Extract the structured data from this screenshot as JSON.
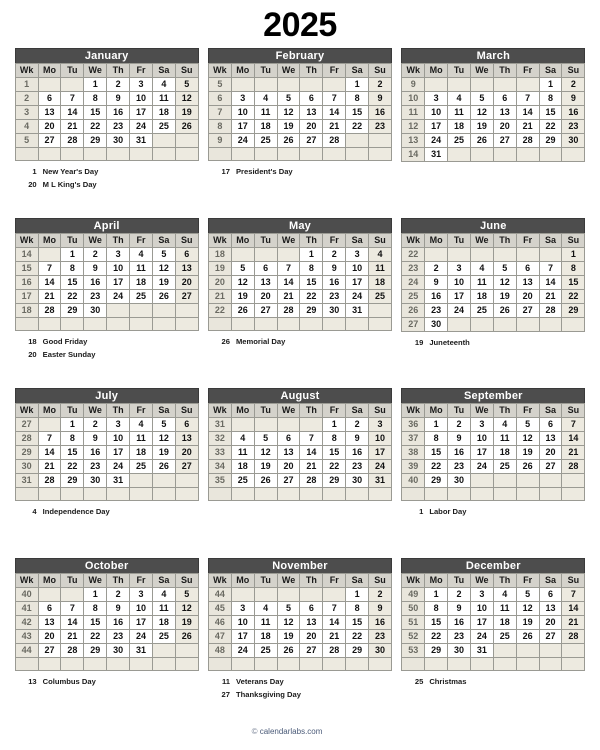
{
  "page": {
    "year_title": "2025",
    "footer": {
      "icon": "copyright-icon",
      "icon_glyph": "©",
      "text": "calendarlabs.com"
    }
  },
  "weekday_headers": [
    "Wk",
    "Mo",
    "Tu",
    "We",
    "Th",
    "Fr",
    "Sa",
    "Su"
  ],
  "months": [
    {
      "name": "January",
      "weeks": [
        {
          "wk": "1",
          "days": [
            "",
            "",
            "1",
            "2",
            "3",
            "4",
            "5"
          ]
        },
        {
          "wk": "2",
          "days": [
            "6",
            "7",
            "8",
            "9",
            "10",
            "11",
            "12"
          ]
        },
        {
          "wk": "3",
          "days": [
            "13",
            "14",
            "15",
            "16",
            "17",
            "18",
            "19"
          ]
        },
        {
          "wk": "4",
          "days": [
            "20",
            "21",
            "22",
            "23",
            "24",
            "25",
            "26"
          ]
        },
        {
          "wk": "5",
          "days": [
            "27",
            "28",
            "29",
            "30",
            "31",
            "",
            ""
          ]
        },
        {
          "wk": "",
          "days": [
            "",
            "",
            "",
            "",
            "",
            "",
            ""
          ]
        }
      ],
      "holidays": [
        {
          "date": "1",
          "name": "New Year's Day"
        },
        {
          "date": "20",
          "name": "M L King's Day"
        }
      ]
    },
    {
      "name": "February",
      "weeks": [
        {
          "wk": "5",
          "days": [
            "",
            "",
            "",
            "",
            "",
            "1",
            "2"
          ]
        },
        {
          "wk": "6",
          "days": [
            "3",
            "4",
            "5",
            "6",
            "7",
            "8",
            "9"
          ]
        },
        {
          "wk": "7",
          "days": [
            "10",
            "11",
            "12",
            "13",
            "14",
            "15",
            "16"
          ]
        },
        {
          "wk": "8",
          "days": [
            "17",
            "18",
            "19",
            "20",
            "21",
            "22",
            "23"
          ]
        },
        {
          "wk": "9",
          "days": [
            "24",
            "25",
            "26",
            "27",
            "28",
            "",
            ""
          ]
        },
        {
          "wk": "",
          "days": [
            "",
            "",
            "",
            "",
            "",
            "",
            ""
          ]
        }
      ],
      "holidays": [
        {
          "date": "17",
          "name": "President's Day"
        }
      ]
    },
    {
      "name": "March",
      "weeks": [
        {
          "wk": "9",
          "days": [
            "",
            "",
            "",
            "",
            "",
            "1",
            "2"
          ]
        },
        {
          "wk": "10",
          "days": [
            "3",
            "4",
            "5",
            "6",
            "7",
            "8",
            "9"
          ]
        },
        {
          "wk": "11",
          "days": [
            "10",
            "11",
            "12",
            "13",
            "14",
            "15",
            "16"
          ]
        },
        {
          "wk": "12",
          "days": [
            "17",
            "18",
            "19",
            "20",
            "21",
            "22",
            "23"
          ]
        },
        {
          "wk": "13",
          "days": [
            "24",
            "25",
            "26",
            "27",
            "28",
            "29",
            "30"
          ]
        },
        {
          "wk": "14",
          "days": [
            "31",
            "",
            "",
            "",
            "",
            "",
            ""
          ]
        }
      ],
      "holidays": []
    },
    {
      "name": "April",
      "weeks": [
        {
          "wk": "14",
          "days": [
            "",
            "1",
            "2",
            "3",
            "4",
            "5",
            "6"
          ]
        },
        {
          "wk": "15",
          "days": [
            "7",
            "8",
            "9",
            "10",
            "11",
            "12",
            "13"
          ]
        },
        {
          "wk": "16",
          "days": [
            "14",
            "15",
            "16",
            "17",
            "18",
            "19",
            "20"
          ]
        },
        {
          "wk": "17",
          "days": [
            "21",
            "22",
            "23",
            "24",
            "25",
            "26",
            "27"
          ]
        },
        {
          "wk": "18",
          "days": [
            "28",
            "29",
            "30",
            "",
            "",
            "",
            ""
          ]
        },
        {
          "wk": "",
          "days": [
            "",
            "",
            "",
            "",
            "",
            "",
            ""
          ]
        }
      ],
      "holidays": [
        {
          "date": "18",
          "name": "Good Friday"
        },
        {
          "date": "20",
          "name": "Easter Sunday"
        }
      ]
    },
    {
      "name": "May",
      "weeks": [
        {
          "wk": "18",
          "days": [
            "",
            "",
            "",
            "1",
            "2",
            "3",
            "4"
          ]
        },
        {
          "wk": "19",
          "days": [
            "5",
            "6",
            "7",
            "8",
            "9",
            "10",
            "11"
          ]
        },
        {
          "wk": "20",
          "days": [
            "12",
            "13",
            "14",
            "15",
            "16",
            "17",
            "18"
          ]
        },
        {
          "wk": "21",
          "days": [
            "19",
            "20",
            "21",
            "22",
            "23",
            "24",
            "25"
          ]
        },
        {
          "wk": "22",
          "days": [
            "26",
            "27",
            "28",
            "29",
            "30",
            "31",
            ""
          ]
        },
        {
          "wk": "",
          "days": [
            "",
            "",
            "",
            "",
            "",
            "",
            ""
          ]
        }
      ],
      "holidays": [
        {
          "date": "26",
          "name": "Memorial Day"
        }
      ]
    },
    {
      "name": "June",
      "weeks": [
        {
          "wk": "22",
          "days": [
            "",
            "",
            "",
            "",
            "",
            "",
            "1"
          ]
        },
        {
          "wk": "23",
          "days": [
            "2",
            "3",
            "4",
            "5",
            "6",
            "7",
            "8"
          ]
        },
        {
          "wk": "24",
          "days": [
            "9",
            "10",
            "11",
            "12",
            "13",
            "14",
            "15"
          ]
        },
        {
          "wk": "25",
          "days": [
            "16",
            "17",
            "18",
            "19",
            "20",
            "21",
            "22"
          ]
        },
        {
          "wk": "26",
          "days": [
            "23",
            "24",
            "25",
            "26",
            "27",
            "28",
            "29"
          ]
        },
        {
          "wk": "27",
          "days": [
            "30",
            "",
            "",
            "",
            "",
            "",
            ""
          ]
        }
      ],
      "holidays": [
        {
          "date": "19",
          "name": "Juneteenth"
        }
      ]
    },
    {
      "name": "July",
      "weeks": [
        {
          "wk": "27",
          "days": [
            "",
            "1",
            "2",
            "3",
            "4",
            "5",
            "6"
          ]
        },
        {
          "wk": "28",
          "days": [
            "7",
            "8",
            "9",
            "10",
            "11",
            "12",
            "13"
          ]
        },
        {
          "wk": "29",
          "days": [
            "14",
            "15",
            "16",
            "17",
            "18",
            "19",
            "20"
          ]
        },
        {
          "wk": "30",
          "days": [
            "21",
            "22",
            "23",
            "24",
            "25",
            "26",
            "27"
          ]
        },
        {
          "wk": "31",
          "days": [
            "28",
            "29",
            "30",
            "31",
            "",
            "",
            ""
          ]
        },
        {
          "wk": "",
          "days": [
            "",
            "",
            "",
            "",
            "",
            "",
            ""
          ]
        }
      ],
      "holidays": [
        {
          "date": "4",
          "name": "Independence Day"
        }
      ]
    },
    {
      "name": "August",
      "weeks": [
        {
          "wk": "31",
          "days": [
            "",
            "",
            "",
            "",
            "1",
            "2",
            "3"
          ]
        },
        {
          "wk": "32",
          "days": [
            "4",
            "5",
            "6",
            "7",
            "8",
            "9",
            "10"
          ]
        },
        {
          "wk": "33",
          "days": [
            "11",
            "12",
            "13",
            "14",
            "15",
            "16",
            "17"
          ]
        },
        {
          "wk": "34",
          "days": [
            "18",
            "19",
            "20",
            "21",
            "22",
            "23",
            "24"
          ]
        },
        {
          "wk": "35",
          "days": [
            "25",
            "26",
            "27",
            "28",
            "29",
            "30",
            "31"
          ]
        },
        {
          "wk": "",
          "days": [
            "",
            "",
            "",
            "",
            "",
            "",
            ""
          ]
        }
      ],
      "holidays": []
    },
    {
      "name": "September",
      "weeks": [
        {
          "wk": "36",
          "days": [
            "1",
            "2",
            "3",
            "4",
            "5",
            "6",
            "7"
          ]
        },
        {
          "wk": "37",
          "days": [
            "8",
            "9",
            "10",
            "11",
            "12",
            "13",
            "14"
          ]
        },
        {
          "wk": "38",
          "days": [
            "15",
            "16",
            "17",
            "18",
            "19",
            "20",
            "21"
          ]
        },
        {
          "wk": "39",
          "days": [
            "22",
            "23",
            "24",
            "25",
            "26",
            "27",
            "28"
          ]
        },
        {
          "wk": "40",
          "days": [
            "29",
            "30",
            "",
            "",
            "",
            "",
            ""
          ]
        },
        {
          "wk": "",
          "days": [
            "",
            "",
            "",
            "",
            "",
            "",
            ""
          ]
        }
      ],
      "holidays": [
        {
          "date": "1",
          "name": "Labor Day"
        }
      ]
    },
    {
      "name": "October",
      "weeks": [
        {
          "wk": "40",
          "days": [
            "",
            "",
            "1",
            "2",
            "3",
            "4",
            "5"
          ]
        },
        {
          "wk": "41",
          "days": [
            "6",
            "7",
            "8",
            "9",
            "10",
            "11",
            "12"
          ]
        },
        {
          "wk": "42",
          "days": [
            "13",
            "14",
            "15",
            "16",
            "17",
            "18",
            "19"
          ]
        },
        {
          "wk": "43",
          "days": [
            "20",
            "21",
            "22",
            "23",
            "24",
            "25",
            "26"
          ]
        },
        {
          "wk": "44",
          "days": [
            "27",
            "28",
            "29",
            "30",
            "31",
            "",
            ""
          ]
        },
        {
          "wk": "",
          "days": [
            "",
            "",
            "",
            "",
            "",
            "",
            ""
          ]
        }
      ],
      "holidays": [
        {
          "date": "13",
          "name": "Columbus Day"
        }
      ]
    },
    {
      "name": "November",
      "weeks": [
        {
          "wk": "44",
          "days": [
            "",
            "",
            "",
            "",
            "",
            "1",
            "2"
          ]
        },
        {
          "wk": "45",
          "days": [
            "3",
            "4",
            "5",
            "6",
            "7",
            "8",
            "9"
          ]
        },
        {
          "wk": "46",
          "days": [
            "10",
            "11",
            "12",
            "13",
            "14",
            "15",
            "16"
          ]
        },
        {
          "wk": "47",
          "days": [
            "17",
            "18",
            "19",
            "20",
            "21",
            "22",
            "23"
          ]
        },
        {
          "wk": "48",
          "days": [
            "24",
            "25",
            "26",
            "27",
            "28",
            "29",
            "30"
          ]
        },
        {
          "wk": "",
          "days": [
            "",
            "",
            "",
            "",
            "",
            "",
            ""
          ]
        }
      ],
      "holidays": [
        {
          "date": "11",
          "name": "Veterans Day"
        },
        {
          "date": "27",
          "name": "Thanksgiving Day"
        }
      ]
    },
    {
      "name": "December",
      "weeks": [
        {
          "wk": "49",
          "days": [
            "1",
            "2",
            "3",
            "4",
            "5",
            "6",
            "7"
          ]
        },
        {
          "wk": "50",
          "days": [
            "8",
            "9",
            "10",
            "11",
            "12",
            "13",
            "14"
          ]
        },
        {
          "wk": "51",
          "days": [
            "15",
            "16",
            "17",
            "18",
            "19",
            "20",
            "21"
          ]
        },
        {
          "wk": "52",
          "days": [
            "22",
            "23",
            "24",
            "25",
            "26",
            "27",
            "28"
          ]
        },
        {
          "wk": "53",
          "days": [
            "29",
            "30",
            "31",
            "",
            "",
            "",
            ""
          ]
        },
        {
          "wk": "",
          "days": [
            "",
            "",
            "",
            "",
            "",
            "",
            ""
          ]
        }
      ],
      "holidays": [
        {
          "date": "25",
          "name": "Christmas"
        }
      ]
    }
  ],
  "colors": {
    "month_header_bg": "#4d4d4d",
    "month_header_text": "#ffffff",
    "dow_header_bg": "#d4d2cb",
    "week_number_bg": "#e9e6dc",
    "sunday_bg": "#edeae0",
    "day_bg": "#ffffff",
    "border": "#9a9a93",
    "outer_border": "#3a3a3a",
    "footer_text": "#4a5a78"
  }
}
